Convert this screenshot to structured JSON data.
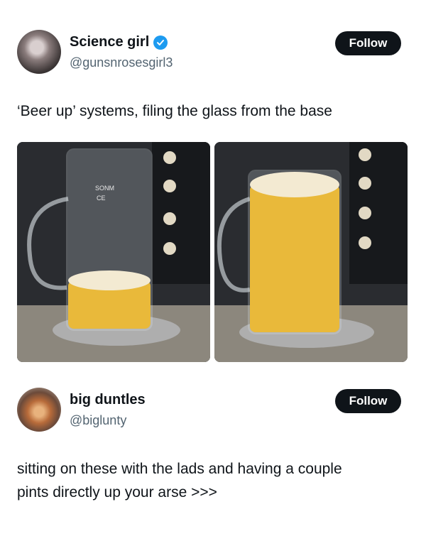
{
  "post1": {
    "author_name": "Science girl",
    "handle": "@gunsnrosesgirl3",
    "follow_label": "Follow",
    "text": "‘Beer up’ systems, filing the glass from the base",
    "media": [
      {
        "beer_fill_fraction": 0.25,
        "glass_label": "SONM",
        "mark": "CE"
      },
      {
        "beer_fill_fraction": 0.95
      }
    ]
  },
  "post2": {
    "author_name": "big duntles",
    "handle": "@biglunty",
    "follow_label": "Follow",
    "text_line1": "sitting on these with the lads and having a couple",
    "text_line2": "pints directly up your arse >>>"
  },
  "colors": {
    "accent": "#1d9bf0",
    "button_bg": "#0f1419",
    "handle": "#536471",
    "beer": "#e9b93a",
    "foam": "#f3ead2"
  },
  "icons": [
    "verified-badge-icon"
  ]
}
